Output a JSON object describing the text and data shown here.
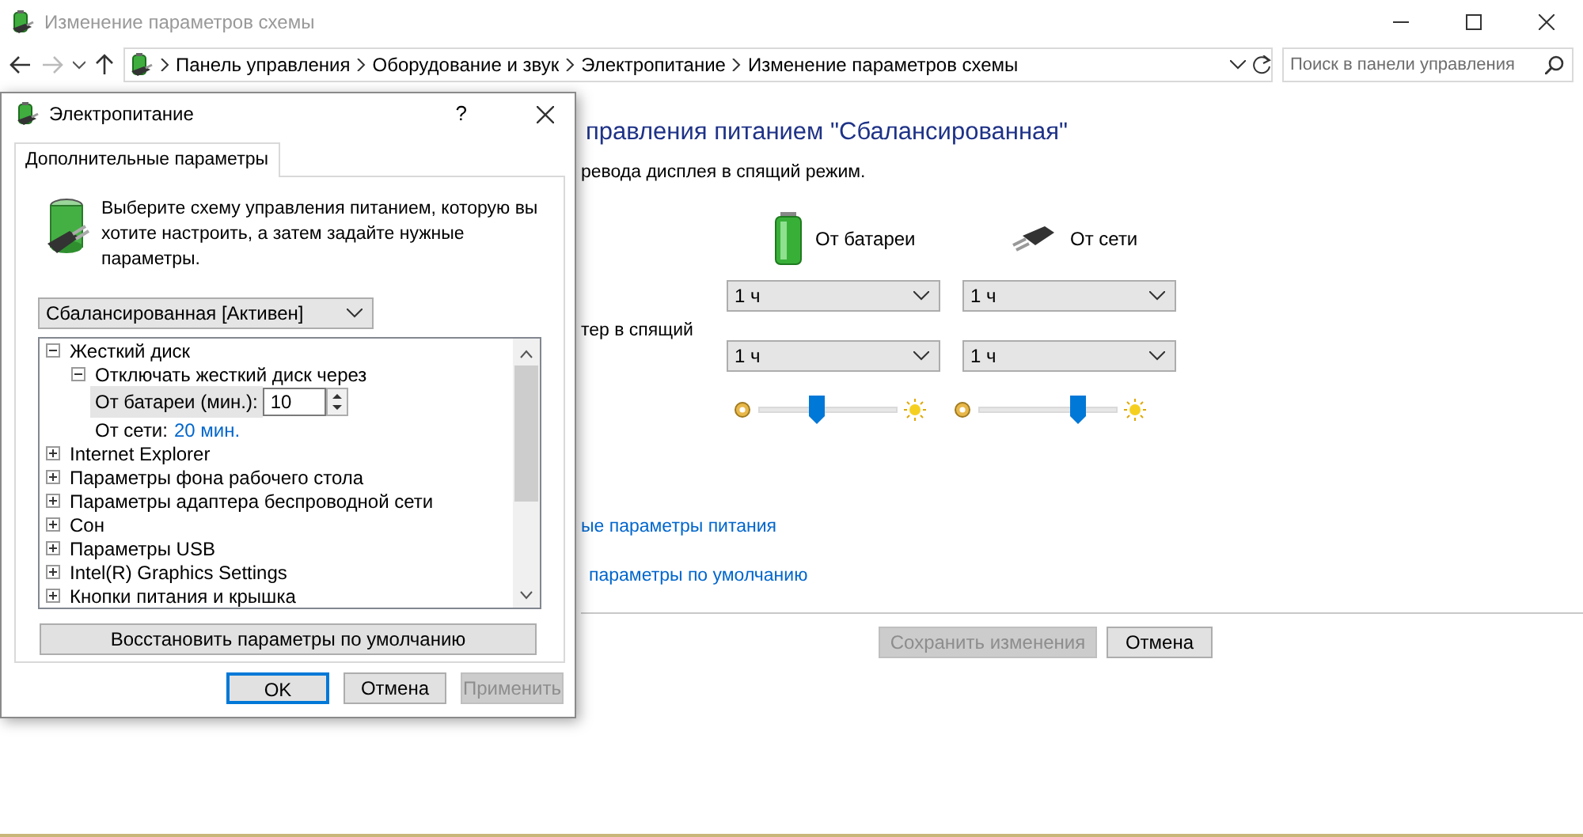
{
  "window": {
    "title": "Изменение параметров схемы",
    "active": false
  },
  "address_bar": {
    "forward_disabled": true,
    "breadcrumbs": [
      "Панель управления",
      "Оборудование и звук",
      "Электропитание",
      "Изменение параметров схемы"
    ]
  },
  "search": {
    "placeholder": "Поиск в панели управления"
  },
  "plan": {
    "heading": "правления питанием \"Сбалансированная\"",
    "subtitle": "ревода дисплея в спящий режим.",
    "columns": [
      {
        "kind": "battery",
        "label": "От батареи"
      },
      {
        "kind": "plug",
        "label": "От сети"
      }
    ],
    "rows": [
      {
        "values": [
          "1 ч",
          "1 ч"
        ]
      },
      {
        "label": "тер в спящий",
        "values": [
          "1 ч",
          "1 ч"
        ]
      }
    ],
    "brightness": [
      {
        "level": 0.42
      },
      {
        "level": 0.72
      }
    ],
    "links": [
      "ые параметры питания",
      "параметры по умолчанию"
    ],
    "buttons": [
      {
        "label": "Сохранить изменения",
        "disabled": true
      },
      {
        "label": "Отмена",
        "disabled": false
      }
    ]
  },
  "dialog": {
    "title": "Электропитание",
    "help": "?",
    "tabs": [
      {
        "label": "Дополнительные параметры",
        "selected": true
      }
    ],
    "intro": "Выберите схему управления питанием, которую вы хотите настроить, а затем задайте нужные параметры.",
    "scheme": "Сбалансированная [Активен]",
    "tree": [
      {
        "label": "Жесткий диск",
        "expanded": true,
        "children": [
          {
            "label": "Отключать жесткий диск через",
            "expanded": true,
            "children": [
              {
                "kind": "spin",
                "label": "От батареи (мин.):",
                "value": "10"
              },
              {
                "kind": "value",
                "label": "От сети:",
                "value": "20 мин."
              }
            ]
          }
        ]
      },
      {
        "label": "Internet Explorer",
        "expanded": false
      },
      {
        "label": "Параметры фона рабочего стола",
        "expanded": false
      },
      {
        "label": "Параметры адаптера беспроводной сети",
        "expanded": false
      },
      {
        "label": "Сон",
        "expanded": false
      },
      {
        "label": "Параметры USB",
        "expanded": false
      },
      {
        "label": "Intel(R) Graphics Settings",
        "expanded": false
      },
      {
        "label": "Кнопки питания и крышка",
        "expanded": false
      }
    ],
    "restore_button": "Восстановить параметры по умолчанию",
    "buttons": [
      {
        "label": "OK",
        "default": true,
        "disabled": false
      },
      {
        "label": "Отмена",
        "default": false,
        "disabled": false
      },
      {
        "label": "Применить",
        "default": false,
        "disabled": true
      }
    ]
  }
}
